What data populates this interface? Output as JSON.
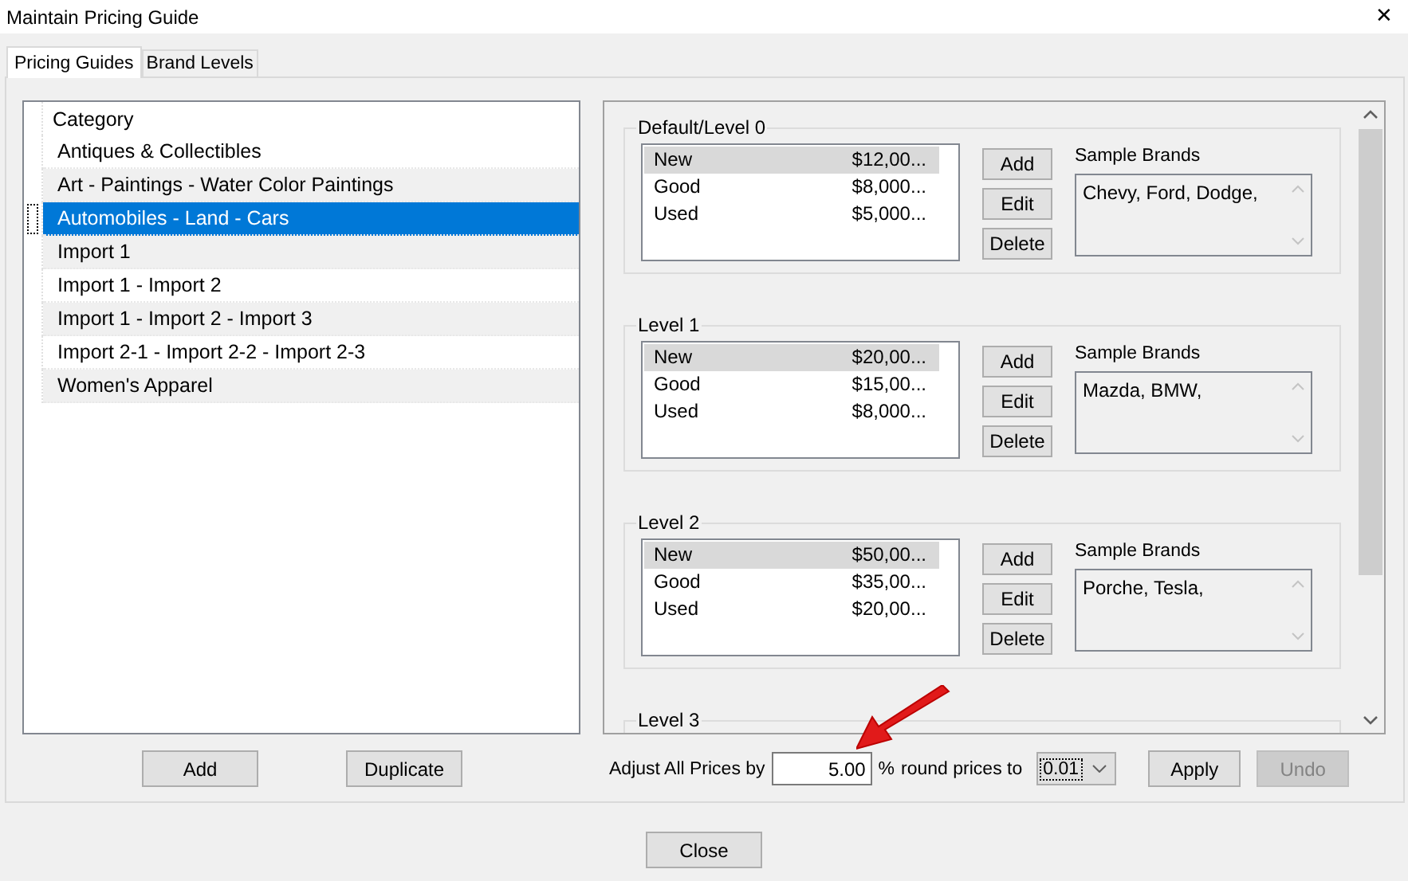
{
  "window": {
    "title": "Maintain Pricing Guide",
    "close": "✕"
  },
  "tabs": [
    {
      "label": "Pricing Guides",
      "selected": true
    },
    {
      "label": "Brand Levels",
      "selected": false
    }
  ],
  "category_list": {
    "header": "Category",
    "items": [
      {
        "label": "Antiques & Collectibles",
        "selected": false
      },
      {
        "label": "Art - Paintings - Water Color Paintings",
        "selected": false
      },
      {
        "label": "Automobiles - Land - Cars",
        "selected": true
      },
      {
        "label": "Import 1",
        "selected": false
      },
      {
        "label": "Import 1 - Import 2",
        "selected": false
      },
      {
        "label": "Import 1 - Import 2 - Import 3",
        "selected": false
      },
      {
        "label": "Import 2-1 - Import 2-2 - Import 2-3",
        "selected": false
      },
      {
        "label": "Women's Apparel",
        "selected": false
      }
    ]
  },
  "category_buttons": [
    "Add",
    "Duplicate"
  ],
  "levels": [
    {
      "title": "Default/Level 0",
      "rows": [
        {
          "condition": "New",
          "price": "$12,00...",
          "selected": true
        },
        {
          "condition": "Good",
          "price": "$8,000...",
          "selected": false
        },
        {
          "condition": "Used",
          "price": "$5,000...",
          "selected": false
        }
      ],
      "buttons": [
        "Add",
        "Edit",
        "Delete"
      ],
      "brands_label": "Sample Brands",
      "brands": "Chevy, Ford, Dodge,"
    },
    {
      "title": "Level 1",
      "rows": [
        {
          "condition": "New",
          "price": "$20,00...",
          "selected": true
        },
        {
          "condition": "Good",
          "price": "$15,00...",
          "selected": false
        },
        {
          "condition": "Used",
          "price": "$8,000...",
          "selected": false
        }
      ],
      "buttons": [
        "Add",
        "Edit",
        "Delete"
      ],
      "brands_label": "Sample Brands",
      "brands": "Mazda, BMW,"
    },
    {
      "title": "Level 2",
      "rows": [
        {
          "condition": "New",
          "price": "$50,00...",
          "selected": true
        },
        {
          "condition": "Good",
          "price": "$35,00...",
          "selected": false
        },
        {
          "condition": "Used",
          "price": "$20,00...",
          "selected": false
        }
      ],
      "buttons": [
        "Add",
        "Edit",
        "Delete"
      ],
      "brands_label": "Sample Brands",
      "brands": "Porche, Tesla,"
    },
    {
      "title": "Level 3"
    }
  ],
  "adjust": {
    "label": "Adjust All Prices by",
    "value": "5.00",
    "unit": "%",
    "round_label": "round prices to",
    "round_value": "0.01",
    "apply": {
      "label": "Apply",
      "disabled": false
    },
    "undo": {
      "label": "Undo",
      "disabled": true
    }
  },
  "close_button": "Close"
}
